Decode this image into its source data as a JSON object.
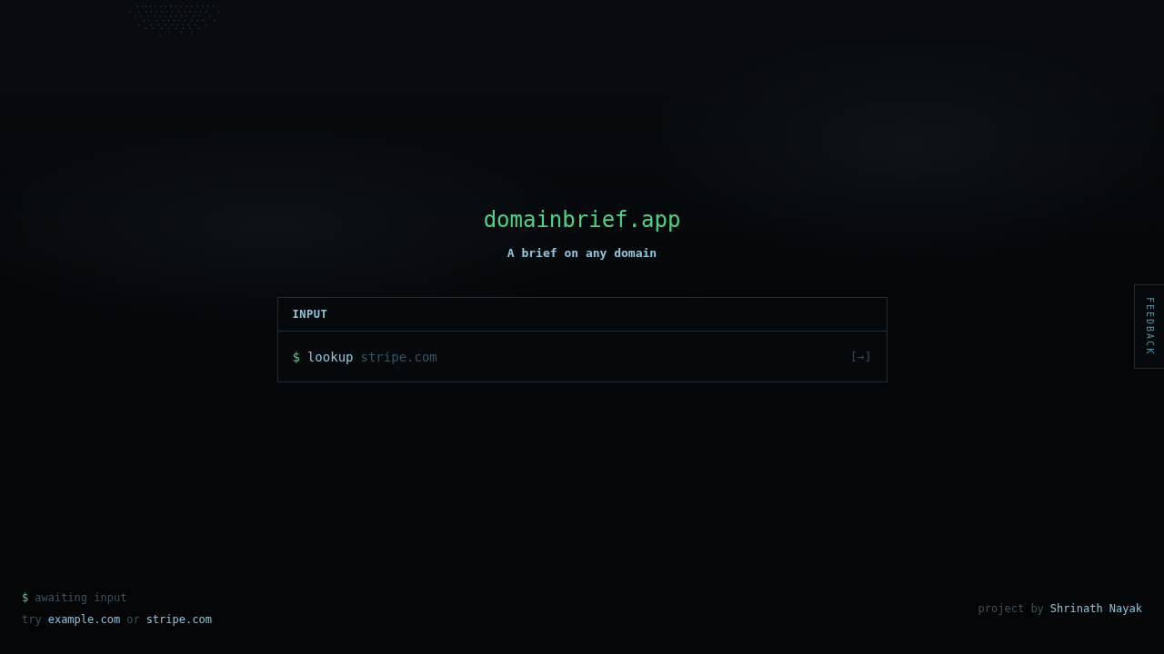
{
  "brand": {
    "title": "domainbrief.app",
    "tagline": "A brief on any domain"
  },
  "input_panel": {
    "header": "INPUT",
    "prompt": "$",
    "command": "lookup",
    "placeholder": "stripe.com",
    "submit": "[→]"
  },
  "feedback_tab": {
    "label": "FEEDBACK"
  },
  "status": {
    "prompt": "$",
    "message": "awaiting input"
  },
  "suggestions": {
    "lead": "try",
    "links": [
      "example.com",
      "stripe.com"
    ],
    "separator": "or"
  },
  "credit": {
    "lead": "project by",
    "author": "Shrinath Nayak"
  }
}
